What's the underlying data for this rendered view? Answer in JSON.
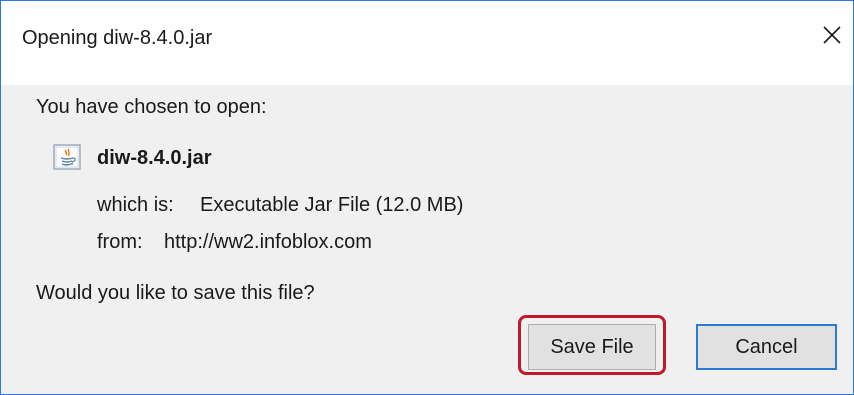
{
  "window": {
    "title": "Opening diw-8.4.0.jar",
    "close_icon": "close-icon"
  },
  "content": {
    "prompt": "You have chosen to open:",
    "file_icon": "java-jar-file-icon",
    "file_name": "diw-8.4.0.jar",
    "type_label": "which is:",
    "type_value": "Executable Jar File (12.0 MB)",
    "from_label": "from:",
    "from_value": "http://ww2.infoblox.com",
    "question": "Would you like to save this file?"
  },
  "buttons": {
    "save_label": "Save File",
    "cancel_label": "Cancel"
  },
  "colors": {
    "dialog_border": "#2b7bd6",
    "dialog_background": "#f0f0f0",
    "highlight": "#c0192e",
    "button_background": "#e1e1e1"
  }
}
